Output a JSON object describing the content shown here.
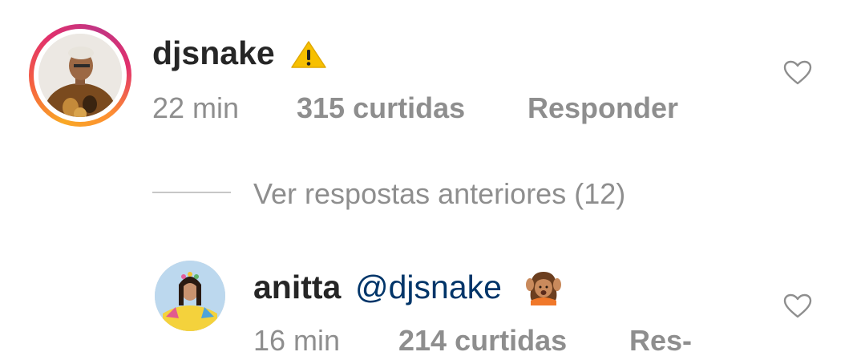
{
  "comments": [
    {
      "username": "djsnake",
      "time": "22 min",
      "likes": "315 curtidas",
      "reply": "Responder",
      "icons": [
        "warning-icon",
        "heart-outline-icon",
        "avatar-story-ring"
      ]
    },
    {
      "username": "anitta",
      "mention": "@djsnake",
      "time": "16 min",
      "likes": "214 curtidas",
      "reply": "Res-",
      "icons": [
        "woman-raising-hands-emoji-icon",
        "heart-outline-icon"
      ]
    }
  ],
  "view_replies": "Ver respostas anteriores (12)",
  "colors": {
    "username": "#262626",
    "meta": "#8e8e8e",
    "mention": "#003569",
    "story_ring": [
      "#f9a825",
      "#e1306c",
      "#c13584"
    ],
    "warning": "#f7c000"
  }
}
